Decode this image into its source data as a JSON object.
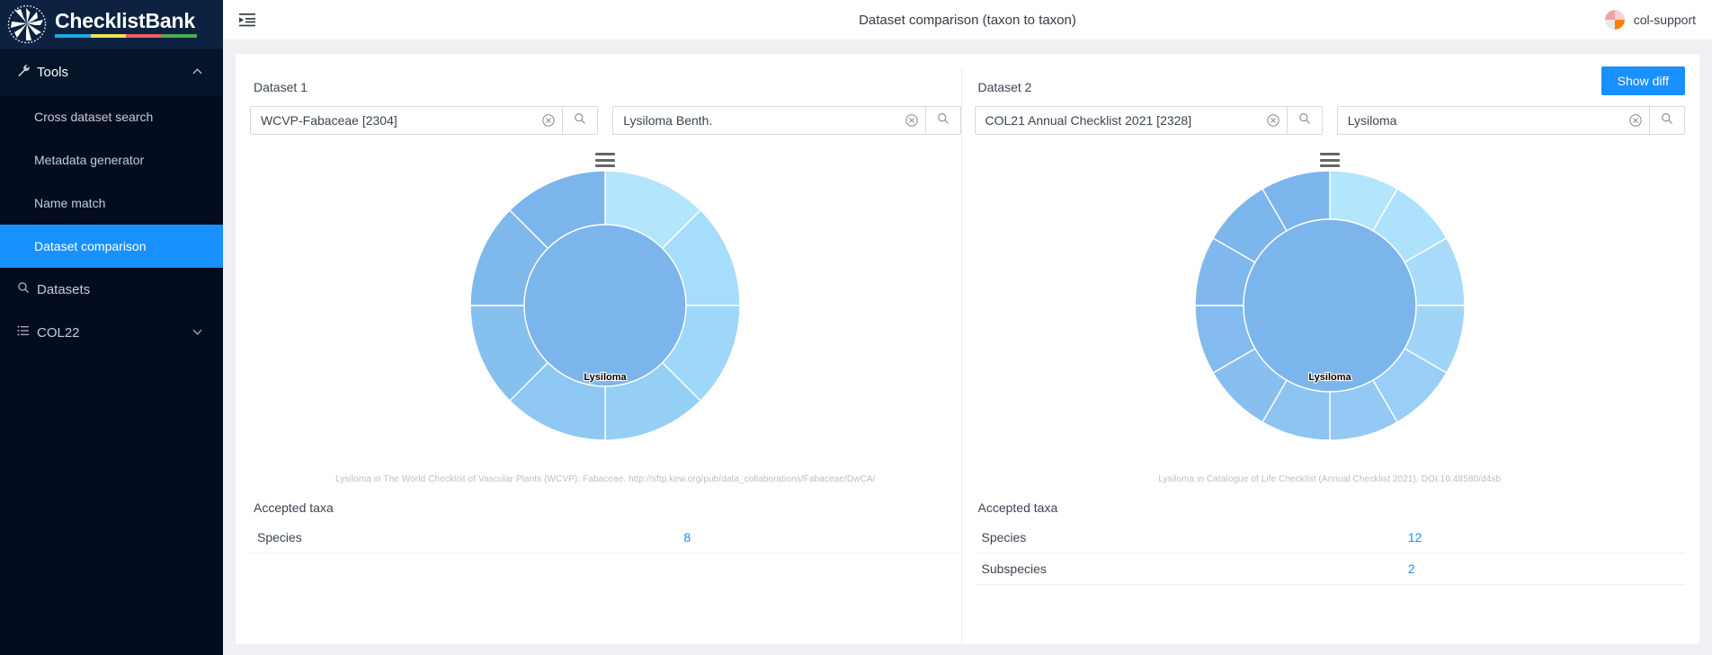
{
  "brand": {
    "name": "ChecklistBank",
    "logo_icon": "checklistbank-flower-logo",
    "rule_colors": [
      "#1fa8e0",
      "#f0e15a",
      "#e8635f",
      "#4caf50"
    ]
  },
  "sidebar": {
    "group": {
      "label": "Tools",
      "icon": "tools-wrench-icon",
      "caret_icon": "chevron-up-icon",
      "expanded": true,
      "items": [
        {
          "label": "Cross dataset search",
          "active": false
        },
        {
          "label": "Metadata generator",
          "active": false
        },
        {
          "label": "Name match",
          "active": false
        },
        {
          "label": "Dataset comparison",
          "active": true
        }
      ]
    },
    "items": [
      {
        "label": "Datasets",
        "icon": "search-icon",
        "caret": false
      },
      {
        "label": "COL22",
        "icon": "list-icon",
        "caret": true,
        "caret_icon": "chevron-down-icon"
      }
    ]
  },
  "topbar": {
    "fold_icon": "menu-fold-icon",
    "title": "Dataset comparison (taxon to taxon)",
    "user": "col-support",
    "avatar_icon": "user-avatar-pie"
  },
  "actions": {
    "show_diff": "Show diff"
  },
  "icons": {
    "clear": "close-circle-icon",
    "search": "search-icon",
    "context_menu": "chart-context-menu-icon"
  },
  "panels": [
    {
      "label": "Dataset 1",
      "dataset_input": {
        "value": "WCVP-Fabaceae  [2304]",
        "placeholder": "Search dataset"
      },
      "taxon_input": {
        "value": "Lysiloma Benth.",
        "placeholder": "Search taxon"
      },
      "credit": "Lysiloma in The World Checklist of Vascular Plants (WCVP): Fabaceae. http://sftp.kew.org/pub/data_collaborations/Fabaceae/DwCA/",
      "taxa_title": "Accepted taxa",
      "taxa_rows": [
        {
          "rank": "Species",
          "count": "8"
        }
      ]
    },
    {
      "label": "Dataset 2",
      "dataset_input": {
        "value": "COL21 Annual Checklist 2021 [2328]",
        "placeholder": "Search dataset"
      },
      "taxon_input": {
        "value": "Lysiloma",
        "placeholder": "Search taxon"
      },
      "credit": "Lysiloma in Catalogue of Life Checklist (Annual Checklist 2021). DOI:10.48580/d4sb",
      "taxa_title": "Accepted taxa",
      "taxa_rows": [
        {
          "rank": "Species",
          "count": "12"
        },
        {
          "rank": "Subspecies",
          "count": "2"
        }
      ]
    }
  ],
  "chart_data": [
    {
      "type": "pie",
      "title": "Lysiloma",
      "subtitle": "Dataset 1 sunburst (WCVP-Fabaceae)",
      "center_label": "Lysiloma",
      "center_color": "#7cb5ec",
      "inner_radius": 0,
      "levels": 2,
      "categories": [
        "Lysiloma"
      ],
      "values": [
        8
      ],
      "outer_ring_segments": 8,
      "slice_colors": [
        "#b3e5fc",
        "#a5ddfa",
        "#9ed7f8",
        "#96cff6",
        "#8ec8f2",
        "#86c0ef",
        "#7fb9ec",
        "#7cb5ec"
      ],
      "legend": "none",
      "grid": false
    },
    {
      "type": "pie",
      "title": "Lysiloma",
      "subtitle": "Dataset 2 sunburst (COL21 Annual Checklist 2021)",
      "center_label": "Lysiloma",
      "center_color": "#7cb5ec",
      "inner_radius": 0,
      "levels": 2,
      "categories": [
        "Lysiloma"
      ],
      "values": [
        12
      ],
      "outer_ring_segments": 12,
      "slice_colors": [
        "#b3e5fc",
        "#aee1fb",
        "#a7dbf9",
        "#a0d5f8",
        "#99cff6",
        "#93c9f4",
        "#8dc4f2",
        "#88bff0",
        "#84bbee",
        "#80b8ed",
        "#7db6ec",
        "#7cb5ec"
      ],
      "legend": "none",
      "grid": false
    }
  ]
}
